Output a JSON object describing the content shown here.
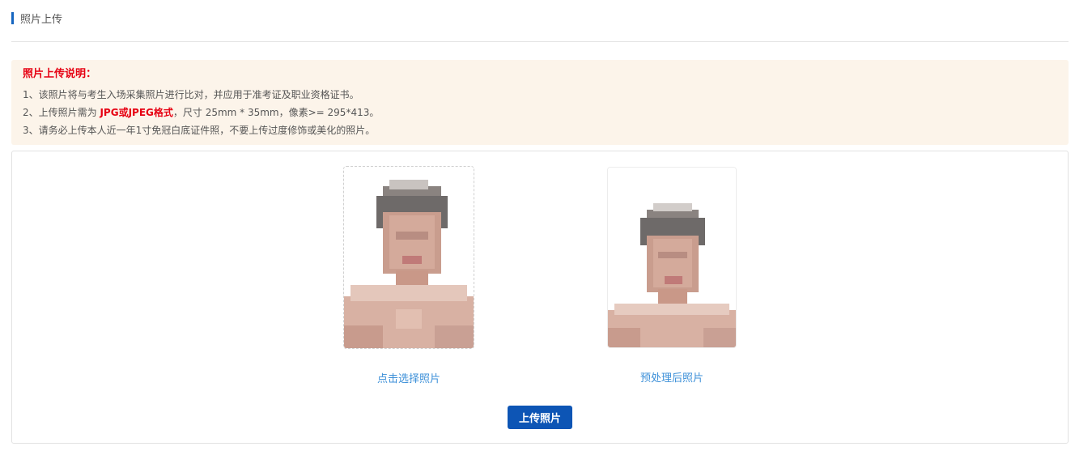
{
  "header": {
    "title": "照片上传"
  },
  "notice": {
    "title": "照片上传说明：",
    "line1": "1、该照片将与考生入场采集照片进行比对，并应用于准考证及职业资格证书。",
    "line2_prefix": "2、上传照片需为 ",
    "line2_highlight": "JPG或JPEG格式",
    "line2_suffix": "，尺寸 25mm * 35mm，像素>= 295*413。",
    "line3": "3、请务必上传本人近一年1寸免冠白底证件照，不要上传过度修饰或美化的照片。",
    "highlight_color": "#e60012"
  },
  "photos": {
    "select_label": "点击选择照片",
    "preview_label": "预处理后照片"
  },
  "actions": {
    "upload_label": "上传照片",
    "button_color": "#0d55b5"
  }
}
